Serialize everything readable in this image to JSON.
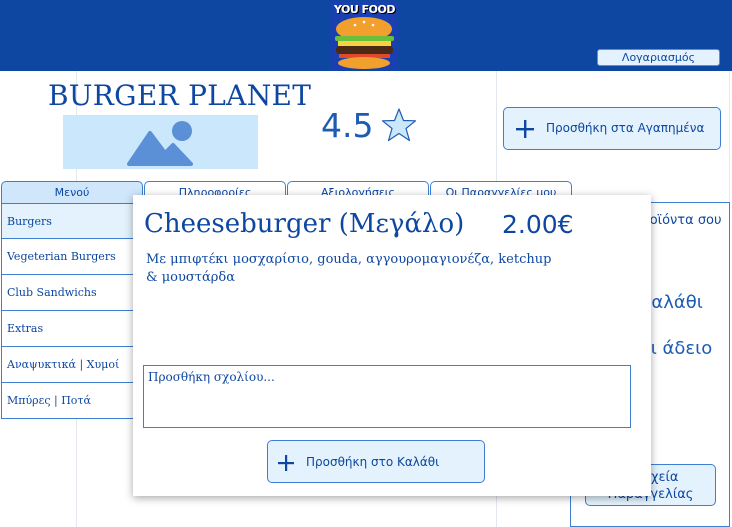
{
  "header": {
    "logo_text": "YOU FOOD",
    "account_label": "Λογαριασμός"
  },
  "store": {
    "name": "BURGER PLANET",
    "rating": "4.5",
    "favorite_label": "Προσθήκη στα Αγαπημένα"
  },
  "tabs": [
    {
      "label": "Μενού"
    },
    {
      "label": "Πληροφορίες"
    },
    {
      "label": "Αξιολογήσεις"
    },
    {
      "label": "Οι Παραγγελίες μου"
    }
  ],
  "categories": [
    {
      "label": "Burgers"
    },
    {
      "label": "Vegeterian Burgers"
    },
    {
      "label": "Club Sandwichs"
    },
    {
      "label": "Extras"
    },
    {
      "label": "Αναψυκτικά | Χυμοί"
    },
    {
      "label": "Μπύρες | Ποτά"
    }
  ],
  "cart": {
    "title": "Τα προϊόντα σου",
    "empty_line1": "Το καλάθι σου",
    "empty_line2": "είναι άδειο",
    "checkout_line1": "Στοιχεία",
    "checkout_line2": "Παραγγελίας"
  },
  "modal": {
    "item_name": "Cheeseburger (Μεγάλο)",
    "price": "2.00€",
    "description": "Με μπιφτέκι μοσχαρίσιο, gouda, αγγουρομαγιονέζα, ketchup & μουστάρδα",
    "comment_placeholder": "Προσθήκη σχολίου...",
    "add_to_cart_label": "Προσθήκη στο Καλάθι"
  },
  "colors": {
    "primary": "#0d47a1",
    "light": "#e3f2fd",
    "accent_border": "#3f7fd1"
  }
}
